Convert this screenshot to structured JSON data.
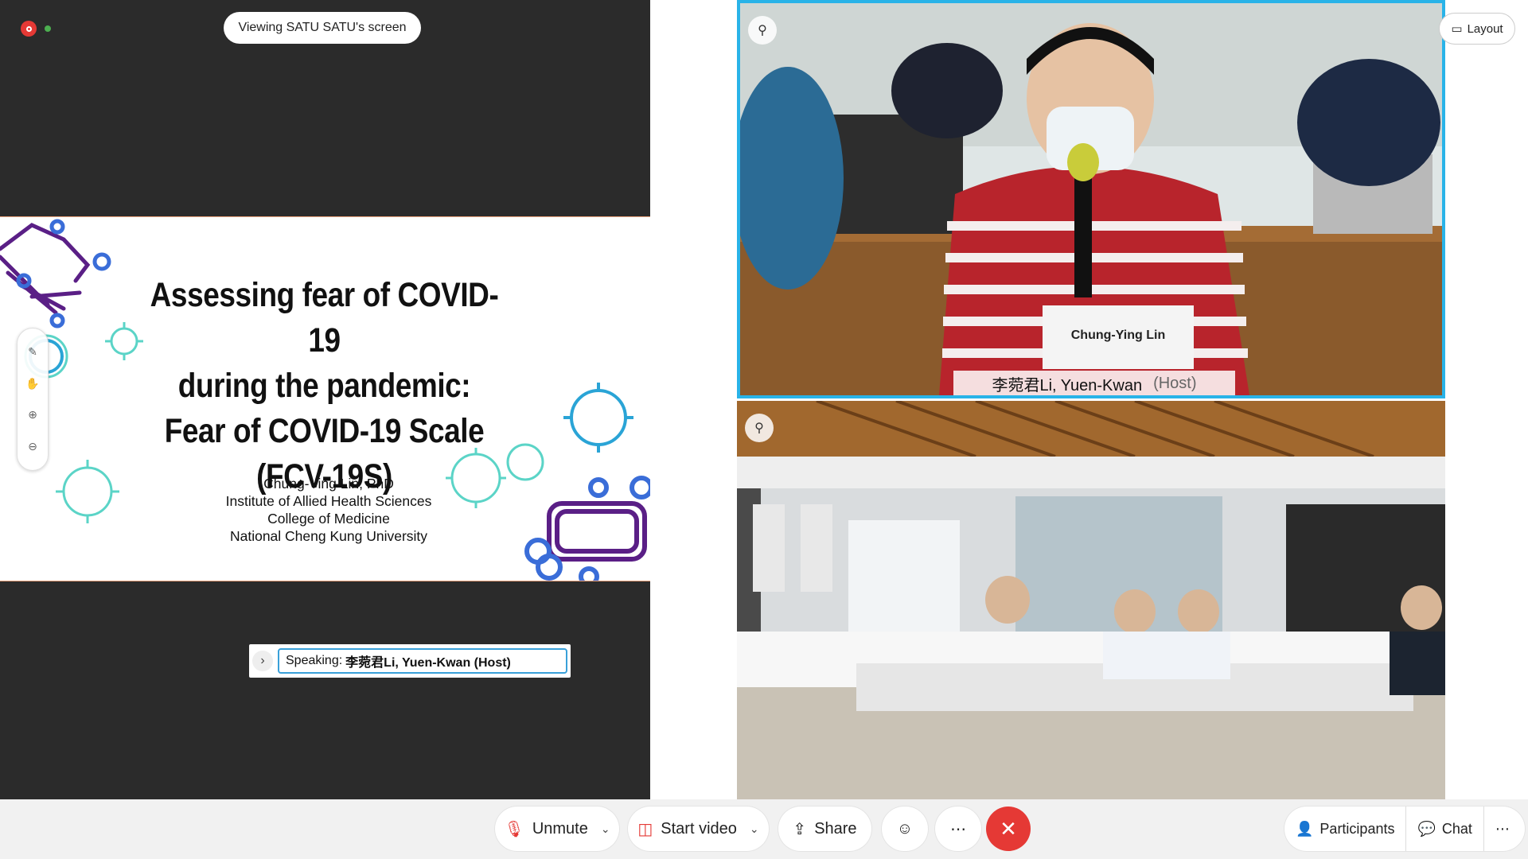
{
  "share_banner": {
    "text": "Viewing SATU SATU's screen"
  },
  "slide": {
    "title_lines": [
      "Assessing fear of COVID-19",
      "during the pandemic:",
      "Fear of COVID-19 Scale",
      "(FCV-19S)"
    ],
    "author_lines": [
      "Chung-Ying Lin, PhD",
      "Institute of Allied Health Sciences",
      "College of Medicine",
      "National Cheng Kung University"
    ]
  },
  "speaking": {
    "prefix": "Speaking:",
    "name": "李菀君Li, Yuen-Kwan (Host)"
  },
  "videos": {
    "primary": {
      "name": "李菀君Li, Yuen-Kwan",
      "role": "(Host)",
      "placard": "Chung-Ying Lin"
    }
  },
  "layout_button": {
    "label": "Layout"
  },
  "toolbar": {
    "unmute_label": "Unmute",
    "video_label": "Start video",
    "share_label": "Share",
    "participants_label": "Participants",
    "chat_label": "Chat"
  },
  "colors": {
    "accent": "#29b3e8",
    "leave": "#e53935",
    "muted": "#e53935"
  }
}
